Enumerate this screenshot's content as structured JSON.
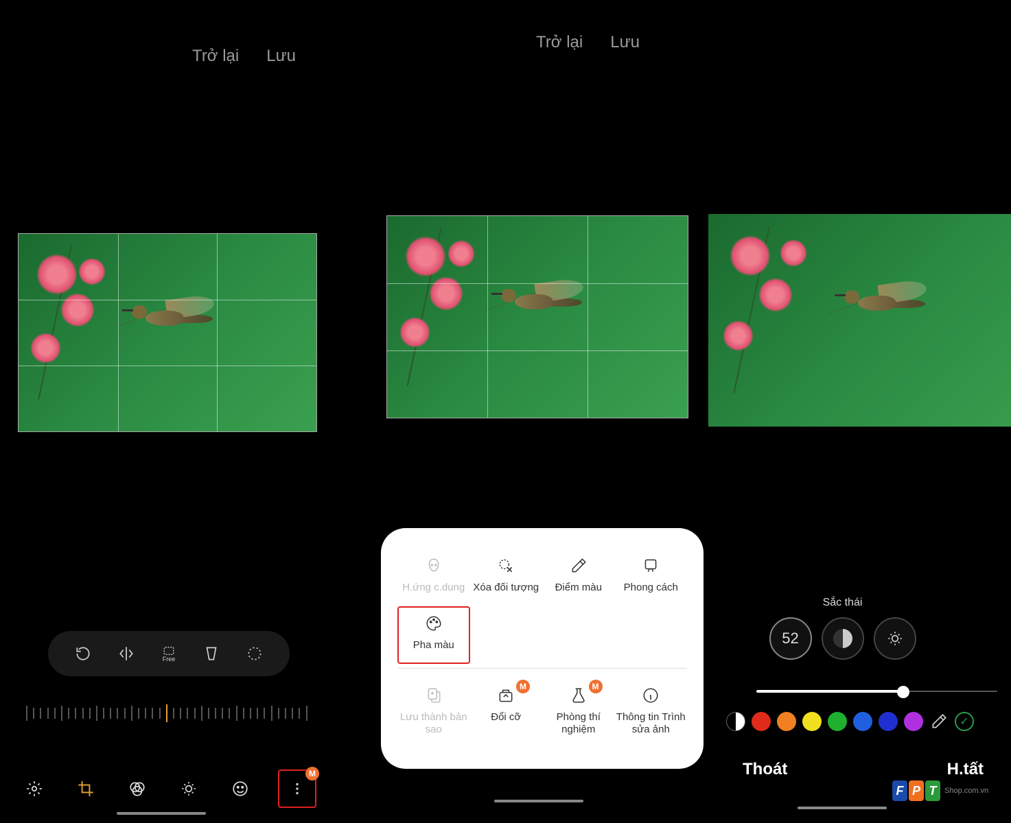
{
  "panel1": {
    "back": "Trở lại",
    "save": "Lưu",
    "crop_tools": {
      "free_label": "Free"
    },
    "nav": {
      "more_badge": "M"
    }
  },
  "panel2": {
    "back": "Trở lại",
    "save": "Lưu",
    "badge": "M",
    "items_top": [
      {
        "label": "H.ứng c.dung",
        "icon": "face",
        "disabled": true
      },
      {
        "label": "Xóa đối tượng",
        "icon": "erase",
        "disabled": false
      },
      {
        "label": "Điểm màu",
        "icon": "dropper",
        "disabled": false
      },
      {
        "label": "Phong cách",
        "icon": "style",
        "disabled": false
      }
    ],
    "items_mid": [
      {
        "label": "Pha màu",
        "icon": "palette",
        "highlighted": true
      }
    ],
    "items_bottom": [
      {
        "label": "Lưu thành bản sao",
        "icon": "copy",
        "disabled": true,
        "badge": false
      },
      {
        "label": "Đổi cỡ",
        "icon": "resize",
        "badge": true
      },
      {
        "label": "Phòng thí nghiệm",
        "icon": "lab",
        "badge": true
      },
      {
        "label": "Thông tin Trình sửa ảnh",
        "icon": "info",
        "badge": false
      }
    ]
  },
  "panel3": {
    "title": "Sắc thái",
    "value": "52",
    "slider_pct": 61,
    "colors": [
      "#e02a1a",
      "#f08020",
      "#f0e020",
      "#20b030",
      "#2060e0",
      "#2030d0",
      "#b030e0"
    ],
    "exit": "Thoát",
    "done": "H.tất"
  },
  "fpt": {
    "f": "F",
    "p": "P",
    "t": "T",
    "shop": "Shop.com.vn"
  }
}
